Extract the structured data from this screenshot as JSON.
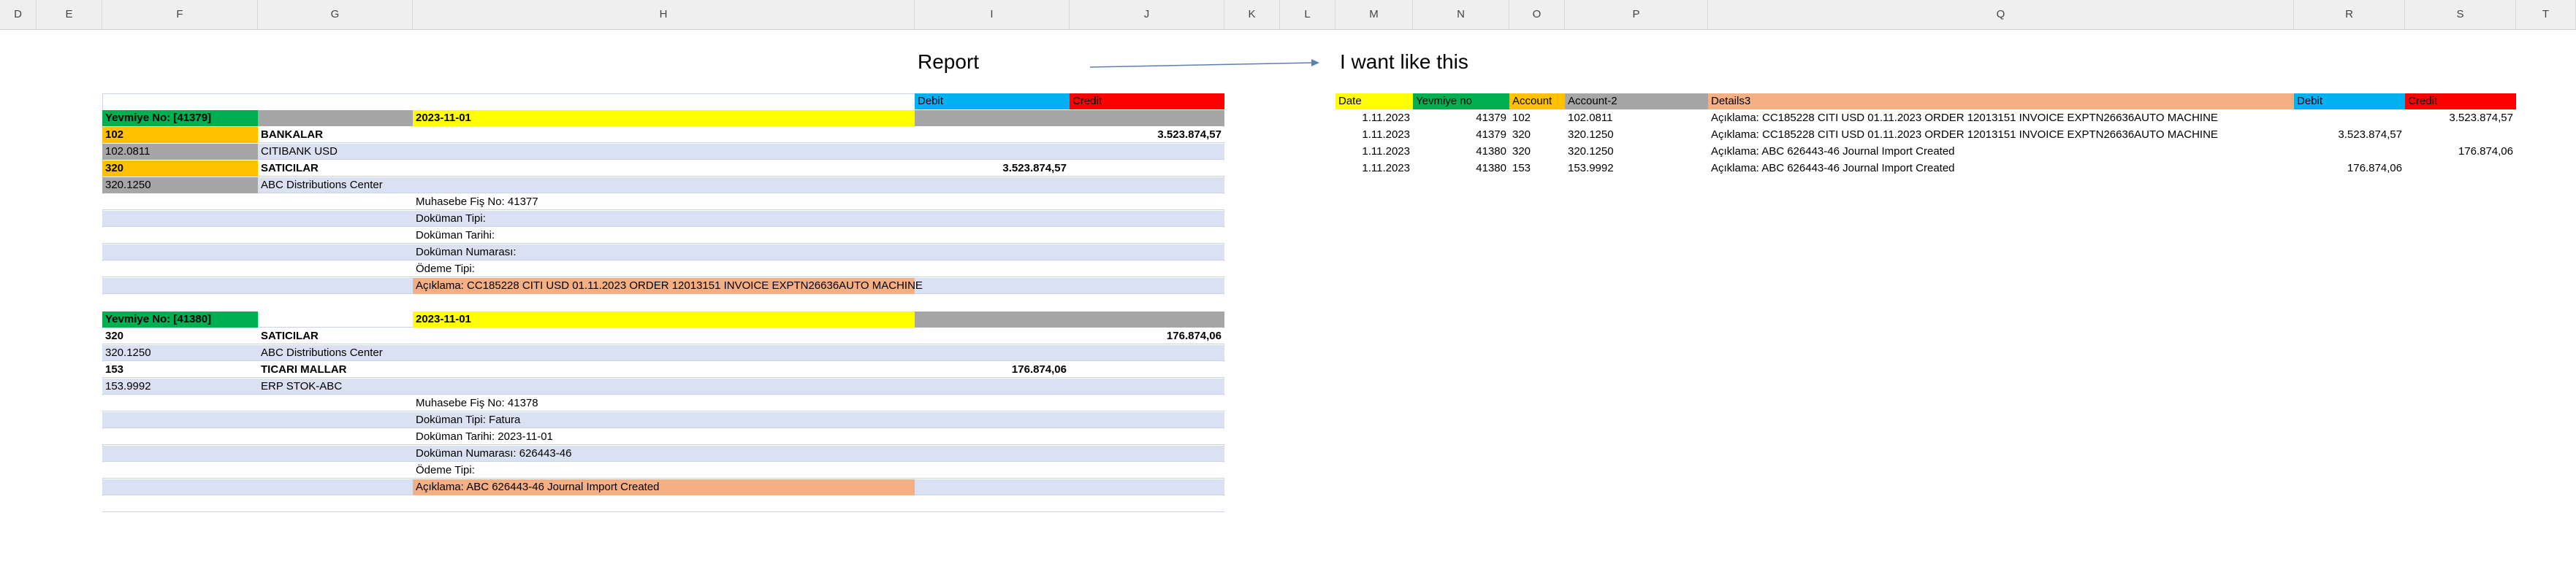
{
  "columns": [
    "D",
    "E",
    "F",
    "G",
    "H",
    "I",
    "J",
    "K",
    "L",
    "M",
    "N",
    "O",
    "P",
    "Q",
    "R",
    "S",
    "T"
  ],
  "report": {
    "title": "Report",
    "header_debit": "Debit",
    "header_credit": "Credit",
    "block1": {
      "yevmiye": "Yevmiye No: [41379]",
      "date": "2023-11-01",
      "lines": [
        {
          "code": "102",
          "name": "BANKALAR",
          "debit": "",
          "credit": "3.523.874,57"
        },
        {
          "code": "102.0811",
          "name": "CITIBANK USD",
          "debit": "",
          "credit": ""
        },
        {
          "code": "320",
          "name": "SATICILAR",
          "debit": "3.523.874,57",
          "credit": ""
        },
        {
          "code": "320.1250",
          "name": "ABC Distributions Center",
          "debit": "",
          "credit": ""
        }
      ],
      "details": [
        "Muhasebe Fiş No: 41377",
        "Doküman Tipi:",
        "Doküman Tarihi:",
        "Doküman Numarası:",
        "Ödeme Tipi:"
      ],
      "aciklama": "Açıklama: CC185228 CITI USD 01.11.2023 ORDER 12013151   INVOICE EXPTN26636AUTO  MACHINE"
    },
    "block2": {
      "yevmiye": "Yevmiye No: [41380]",
      "date": "2023-11-01",
      "lines": [
        {
          "code": "320",
          "name": "SATICILAR",
          "debit": "",
          "credit": "176.874,06"
        },
        {
          "code": "320.1250",
          "name": "ABC Distributions Center",
          "debit": "",
          "credit": ""
        },
        {
          "code": "153",
          "name": "TICARI MALLAR",
          "debit": "176.874,06",
          "credit": ""
        },
        {
          "code": "153.9992",
          "name": "ERP STOK-ABC",
          "debit": "",
          "credit": ""
        }
      ],
      "details": [
        "Muhasebe Fiş No: 41378",
        "Doküman Tipi: Fatura",
        "Doküman Tarihi: 2023-11-01",
        "Doküman Numarası: 626443-46",
        "Ödeme Tipi:"
      ],
      "aciklama": "Açıklama: ABC 626443-46 Journal Import Created"
    }
  },
  "target": {
    "title": "I want like this",
    "headers": [
      "Date",
      "Yevmiye no",
      "Account",
      "Account-2",
      "Details3",
      "Debit",
      "Credit"
    ],
    "rows": [
      [
        "1.11.2023",
        "41379",
        "102",
        "102.0811",
        "Açıklama: CC185228 CITI USD 01.11.2023 ORDER 12013151   INVOICE EXPTN26636AUTO  MACHINE",
        "",
        "3.523.874,57"
      ],
      [
        "1.11.2023",
        "41379",
        "320",
        "320.1250",
        "Açıklama: CC185228 CITI USD 01.11.2023 ORDER 12013151   INVOICE EXPTN26636AUTO  MACHINE",
        "3.523.874,57",
        ""
      ],
      [
        "1.11.2023",
        "41380",
        "320",
        "320.1250",
        "Açıklama: ABC 626443-46 Journal Import Created",
        "",
        "176.874,06"
      ],
      [
        "1.11.2023",
        "41380",
        "153",
        "153.9992",
        "Açıklama: ABC 626443-46 Journal Import Created",
        "176.874,06",
        ""
      ]
    ]
  },
  "colors": {
    "green": "#00b050",
    "yellow": "#ffff00",
    "orange": "#ffc000",
    "gray": "#a6a6a6",
    "blue": "#00b0f0",
    "red": "#ff0000",
    "peach": "#f4b084",
    "band": "#d9e1f2"
  }
}
